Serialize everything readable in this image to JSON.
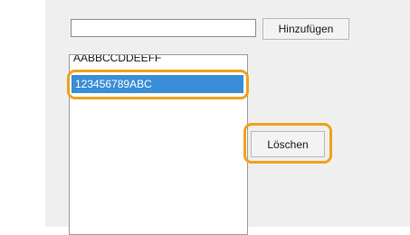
{
  "input": {
    "value": "",
    "placeholder": ""
  },
  "buttons": {
    "add_label": "Hinzufügen",
    "delete_label": "Löschen"
  },
  "list": {
    "items": [
      {
        "label": "AABBCCDDEEFF",
        "selected": false
      },
      {
        "label": "123456789ABC",
        "selected": true
      }
    ]
  },
  "colors": {
    "panel_background": "#efefef",
    "selection": "#3a8ed8",
    "callout_highlight": "#f0a21e"
  }
}
